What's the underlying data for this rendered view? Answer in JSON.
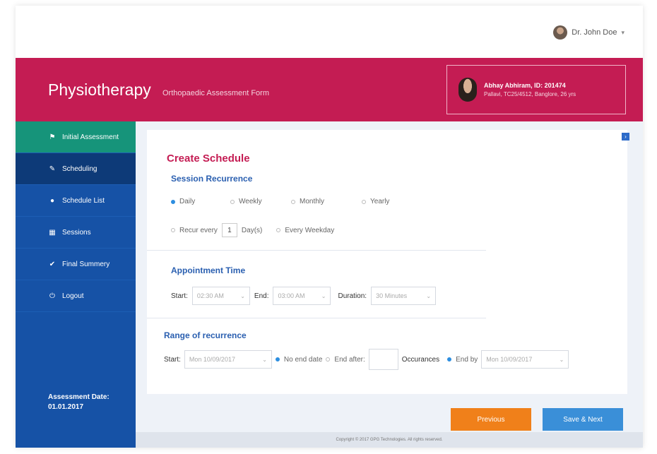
{
  "header": {
    "user_name": "Dr. John Doe"
  },
  "banner": {
    "title": "Physiotherapy",
    "subtitle": "Orthopaedic Assessment Form",
    "patient_name": "Abhay Abhiram, ID: 201474",
    "patient_detail": "Pallavi, TC25/4512, Banglore, 26 yrs"
  },
  "sidebar": {
    "items": [
      {
        "label": "Initial Assessment",
        "icon": "flag-icon"
      },
      {
        "label": "Scheduling",
        "icon": "pencil-icon"
      },
      {
        "label": "Schedule List",
        "icon": "info-circle-icon"
      },
      {
        "label": "Sessions",
        "icon": "table-icon"
      },
      {
        "label": "Final Summery",
        "icon": "check-icon"
      },
      {
        "label": "Logout",
        "icon": "power-icon"
      }
    ],
    "assessment_date_label": "Assessment Date:",
    "assessment_date": "01.01.2017"
  },
  "form": {
    "heading": "Create Schedule",
    "session_recurrence": {
      "heading": "Session Recurrence",
      "options": [
        "Daily",
        "Weekly",
        "Monthly",
        "Yearly"
      ],
      "selected": "Daily",
      "recur_every_label": "Recur every",
      "recur_every_value": "1",
      "recur_unit": "Day(s)",
      "every_weekday": "Every Weekday"
    },
    "appointment_time": {
      "heading": "Appointment Time",
      "start_label": "Start:",
      "start_value": "02:30 AM",
      "end_label": "End:",
      "end_value": "03:00 AM",
      "duration_label": "Duration:",
      "duration_value": "30 Minutes"
    },
    "range": {
      "heading": "Range of recurrence",
      "start_label": "Start:",
      "start_value": "Mon 10/09/2017",
      "no_end": "No end date",
      "end_after": "End after:",
      "occurrences": "Occurances",
      "end_by": "End by",
      "end_by_value": "Mon 10/09/2017"
    }
  },
  "buttons": {
    "previous": "Previous",
    "save_next": "Save & Next"
  },
  "footer": {
    "text": "Copyright © 2017 GPG Technologies. All rights reserved."
  },
  "colors": {
    "brand": "#c41c53",
    "sidebar": "#1652a6",
    "active": "#16947a",
    "previous": "#f0801a",
    "next": "#3a8fd8"
  }
}
